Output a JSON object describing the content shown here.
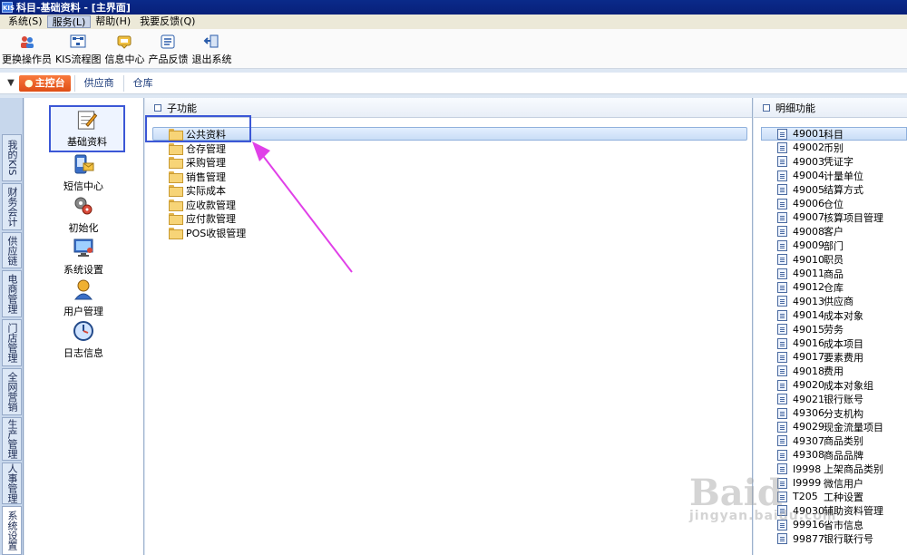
{
  "title": "科目-基础资料 - [主界面]",
  "logo_text": "KIS",
  "menu": [
    "系统(S)",
    "服务(L)",
    "帮助(H)",
    "我要反馈(Q)"
  ],
  "menu_active_index": 1,
  "toolbar": [
    {
      "label": "更换操作员",
      "icon": "switch-user-icon"
    },
    {
      "label": "KIS流程图",
      "icon": "flowchart-icon"
    },
    {
      "label": "信息中心",
      "icon": "info-center-icon"
    },
    {
      "label": "产品反馈",
      "icon": "feedback-icon"
    },
    {
      "label": "退出系统",
      "icon": "exit-icon"
    }
  ],
  "tabs": {
    "main": "主控台",
    "others": [
      "供应商",
      "仓库"
    ]
  },
  "left_nav": [
    "我的KIS",
    "财务会计",
    "供应链",
    "电商管理",
    "门店管理",
    "全网营销",
    "生产管理",
    "人事管理",
    "系统设置"
  ],
  "functions": [
    {
      "label": "基础资料",
      "icon": "base-data-icon",
      "selected": true
    },
    {
      "label": "短信中心",
      "icon": "sms-center-icon"
    },
    {
      "label": "初始化",
      "icon": "initialize-icon"
    },
    {
      "label": "系统设置",
      "icon": "system-settings-icon"
    },
    {
      "label": "用户管理",
      "icon": "user-management-icon"
    },
    {
      "label": "日志信息",
      "icon": "log-info-icon"
    }
  ],
  "sub_panel": {
    "header": "子功能",
    "items": [
      "公共资料",
      "仓存管理",
      "采购管理",
      "销售管理",
      "实际成本",
      "应收款管理",
      "应付款管理",
      "POS收银管理"
    ],
    "selected_index": 0
  },
  "detail_panel": {
    "header": "明细功能",
    "items": [
      {
        "code": "49001",
        "name": "科目"
      },
      {
        "code": "49002",
        "name": "币别"
      },
      {
        "code": "49003",
        "name": "凭证字"
      },
      {
        "code": "49004",
        "name": "计量单位"
      },
      {
        "code": "49005",
        "name": "结算方式"
      },
      {
        "code": "49006",
        "name": "仓位"
      },
      {
        "code": "49007",
        "name": "核算项目管理"
      },
      {
        "code": "49008",
        "name": "客户"
      },
      {
        "code": "49009",
        "name": "部门"
      },
      {
        "code": "49010",
        "name": "职员"
      },
      {
        "code": "49011",
        "name": "商品"
      },
      {
        "code": "49012",
        "name": "仓库"
      },
      {
        "code": "49013",
        "name": "供应商"
      },
      {
        "code": "49014",
        "name": "成本对象"
      },
      {
        "code": "49015",
        "name": "劳务"
      },
      {
        "code": "49016",
        "name": "成本项目"
      },
      {
        "code": "49017",
        "name": "要素费用"
      },
      {
        "code": "49018",
        "name": "费用"
      },
      {
        "code": "49020",
        "name": "成本对象组"
      },
      {
        "code": "49021",
        "name": "银行账号"
      },
      {
        "code": "49306",
        "name": "分支机构"
      },
      {
        "code": "49029",
        "name": "现金流量项目"
      },
      {
        "code": "49307",
        "name": "商品类别"
      },
      {
        "code": "49308",
        "name": "商品品牌"
      },
      {
        "code": "I9998",
        "name": "上架商品类别"
      },
      {
        "code": "I9999",
        "name": "微信用户"
      },
      {
        "code": "T205",
        "name": "工种设置"
      },
      {
        "code": "49030",
        "name": "辅助资料管理"
      },
      {
        "code": "99916",
        "name": "省市信息"
      },
      {
        "code": "99877",
        "name": "银行联行号"
      }
    ],
    "selected_index": 0
  },
  "watermark": {
    "main": "Baid",
    "sub": "jingyan.baidu.com"
  },
  "colors": {
    "accent": "#3b57d6",
    "annotation_arrow": "#e040e8",
    "tab_orange": "#df4e16"
  }
}
